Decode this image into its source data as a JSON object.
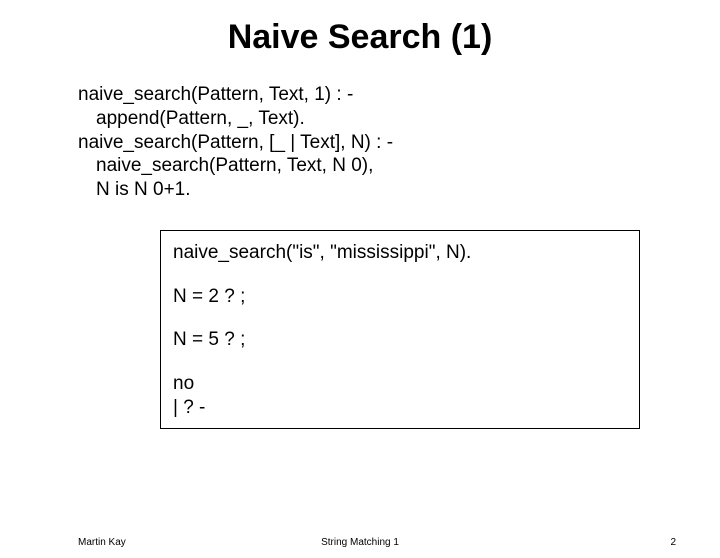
{
  "title": "Naive Search (1)",
  "code": {
    "l1": "naive_search(Pattern, Text, 1) : -",
    "l2": "append(Pattern, _, Text).",
    "l3": "naive_search(Pattern, [_ | Text], N) : -",
    "l4": "naive_search(Pattern, Text, N 0),",
    "l5": "N is N 0+1."
  },
  "box": {
    "b1": "naive_search(\"is\", \"mississippi\", N).",
    "b2": "N = 2 ? ;",
    "b3": "N = 5 ? ;",
    "b4": "no",
    "b5": "| ? -"
  },
  "footer": {
    "left": "Martin Kay",
    "center": "String Matching 1",
    "right": "2"
  }
}
